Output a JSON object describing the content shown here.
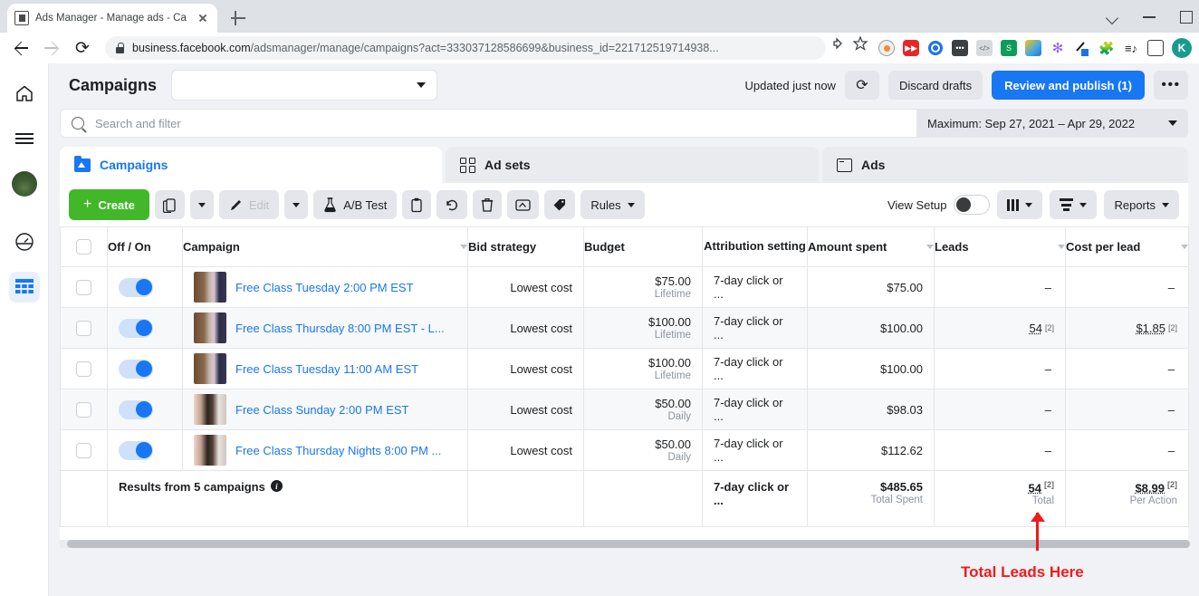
{
  "browser": {
    "tab_title": "Ads Manager - Manage ads - Ca",
    "url_bold": "business.facebook.com",
    "url_rest": "/adsmanager/manage/campaigns?act=333037128586699&business_id=221712519714938...",
    "avatar_initial": "K"
  },
  "header": {
    "title": "Campaigns",
    "account_selector_value": "",
    "updated_label": "Updated just now",
    "refresh_icon": "refresh-icon",
    "discard_label": "Discard drafts",
    "publish_label": "Review and publish (1)",
    "more_label": "•••"
  },
  "search": {
    "placeholder": "Search and filter",
    "date_range": "Maximum: Sep 27, 2021 – Apr 29, 2022"
  },
  "tabs": [
    {
      "label": "Campaigns",
      "icon": "folder-icon",
      "active": true
    },
    {
      "label": "Ad sets",
      "icon": "grid-icon",
      "active": false
    },
    {
      "label": "Ads",
      "icon": "window-icon",
      "active": false
    }
  ],
  "toolbar": {
    "create_label": "Create",
    "duplicate_icon": "duplicate-icon",
    "duplicate_caret": "chevron-down-icon",
    "edit_label": "Edit",
    "edit_caret": "chevron-down-icon",
    "abtest_label": "A/B Test",
    "clipboard_icon": "clipboard-icon",
    "undo_icon": "undo-icon",
    "delete_icon": "trash-icon",
    "export_icon": "export-icon",
    "tag_icon": "tag-icon",
    "rules_label": "Rules",
    "view_setup_label": "View Setup",
    "columns_label": "columns-icon",
    "breakdown_label": "breakdown-icon",
    "reports_label": "Reports"
  },
  "table": {
    "columns": [
      {
        "key": "check",
        "label": ""
      },
      {
        "key": "offon",
        "label": "Off / On"
      },
      {
        "key": "campaign",
        "label": "Campaign",
        "sortable": true
      },
      {
        "key": "bid",
        "label": "Bid strategy"
      },
      {
        "key": "budget",
        "label": "Budget"
      },
      {
        "key": "attribution",
        "label": "Attribution setting"
      },
      {
        "key": "spent",
        "label": "Amount spent",
        "sortable": true
      },
      {
        "key": "leads",
        "label": "Leads",
        "sortable": true
      },
      {
        "key": "cpl",
        "label": "Cost per lead",
        "sortable": true
      }
    ],
    "rows": [
      {
        "name": "Free Class Tuesday 2:00 PM EST",
        "bid": "Lowest cost",
        "budget": "$75.00",
        "budget_type": "Lifetime",
        "attribution": "7-day click or ...",
        "spent": "$75.00",
        "leads": "–",
        "leads_sup": "",
        "cpl": "–",
        "cpl_sup": "",
        "thumb": "a"
      },
      {
        "name": "Free Class Thursday 8:00 PM EST - L...",
        "bid": "Lowest cost",
        "budget": "$100.00",
        "budget_type": "Lifetime",
        "attribution": "7-day click or ...",
        "spent": "$100.00",
        "leads": "54",
        "leads_sup": "[2]",
        "cpl": "$1.85",
        "cpl_sup": "[2]",
        "thumb": "a"
      },
      {
        "name": "Free Class Tuesday 11:00 AM EST",
        "bid": "Lowest cost",
        "budget": "$100.00",
        "budget_type": "Lifetime",
        "attribution": "7-day click or ...",
        "spent": "$100.00",
        "leads": "–",
        "leads_sup": "",
        "cpl": "–",
        "cpl_sup": "",
        "thumb": "a"
      },
      {
        "name": "Free Class Sunday 2:00 PM EST",
        "bid": "Lowest cost",
        "budget": "$50.00",
        "budget_type": "Daily",
        "attribution": "7-day click or ...",
        "spent": "$98.03",
        "leads": "–",
        "leads_sup": "",
        "cpl": "–",
        "cpl_sup": "",
        "thumb": "b"
      },
      {
        "name": "Free Class Thursday Nights 8:00 PM ...",
        "bid": "Lowest cost",
        "budget": "$50.00",
        "budget_type": "Daily",
        "attribution": "7-day click or ...",
        "spent": "$112.62",
        "leads": "–",
        "leads_sup": "",
        "cpl": "–",
        "cpl_sup": "",
        "thumb": "b"
      }
    ],
    "footer": {
      "label": "Results from 5 campaigns",
      "attribution": "7-day click or ...",
      "spent": "$485.65",
      "spent_sub": "Total Spent",
      "leads": "54",
      "leads_sup": "[2]",
      "leads_sub": "Total",
      "cpl": "$8.99",
      "cpl_sup": "[2]",
      "cpl_sub": "Per Action"
    }
  },
  "annotation": {
    "text": "Total Leads Here",
    "color": "#ee1c1c"
  },
  "rail": {
    "items": [
      "home-icon",
      "menu-icon",
      "profile-avatar",
      "dashboard-icon",
      "table-icon"
    ]
  }
}
